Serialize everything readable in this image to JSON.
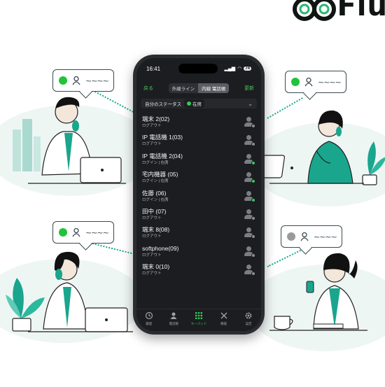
{
  "brand": {
    "text": "Flu"
  },
  "phone": {
    "time": "16:41",
    "battery": "74",
    "nav": {
      "back": "戻る",
      "seg_outside": "外線ライン",
      "seg_inside": "内線 電話帳",
      "update": "更新"
    },
    "my_status": {
      "label": "自分のステータス",
      "value": "在席"
    },
    "contacts": [
      {
        "name": "端末 2(02)",
        "status": "ログアウト",
        "online": false
      },
      {
        "name": "IP 電話機 1(03)",
        "status": "ログアウト",
        "online": false
      },
      {
        "name": "IP 電話機 2(04)",
        "status": "ログイン | 在席",
        "online": true
      },
      {
        "name": "宅内機器 (05)",
        "status": "ログイン | 在席",
        "online": true
      },
      {
        "name": "佐藤 (06)",
        "status": "ログイン | 在席",
        "online": true
      },
      {
        "name": "田中 (07)",
        "status": "ログアウト",
        "online": false
      },
      {
        "name": "端末 8(08)",
        "status": "ログアウト",
        "online": false
      },
      {
        "name": "softphone(09)",
        "status": "ログアウト",
        "online": false
      },
      {
        "name": "端末 0(10)",
        "status": "ログアウト",
        "online": false
      }
    ],
    "tabs": [
      {
        "label": "履歴",
        "icon": "clock-icon"
      },
      {
        "label": "電話帳",
        "icon": "contacts-icon"
      },
      {
        "label": "キーパッド",
        "icon": "keypad-icon"
      },
      {
        "label": "機能",
        "icon": "tools-icon"
      },
      {
        "label": "設定",
        "icon": "gear-icon"
      }
    ]
  },
  "bubbles": {
    "tilde": "~~~~",
    "colors": {
      "online": "#22c33a",
      "offline": "#9a9a9a",
      "person": "#3b4a52"
    }
  }
}
